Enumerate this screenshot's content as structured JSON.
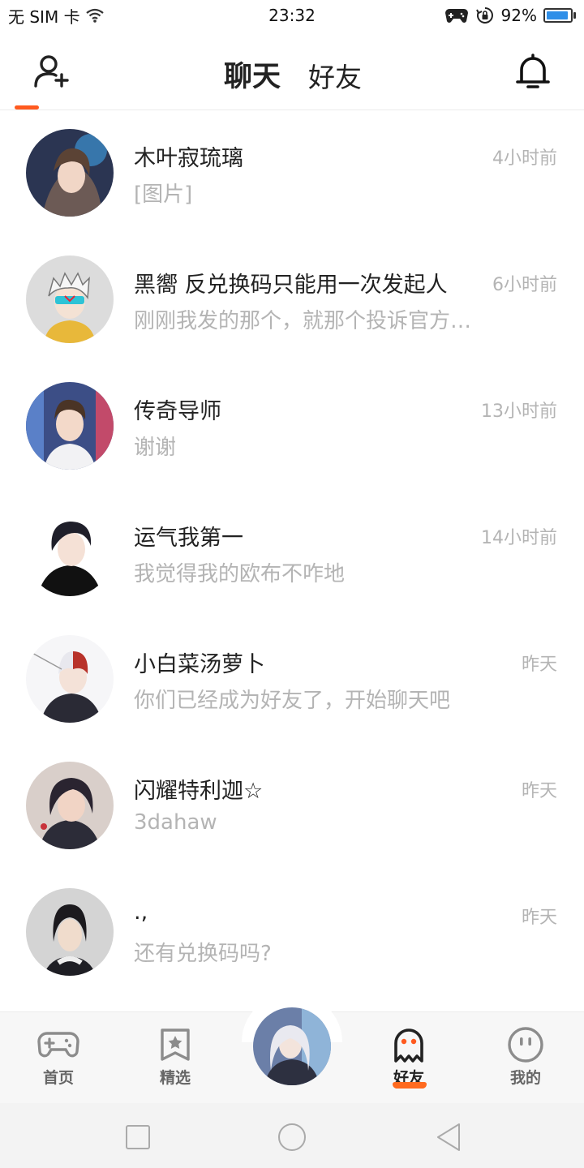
{
  "status_bar": {
    "carrier": "无 SIM 卡",
    "time": "23:32",
    "battery_percent": "92%",
    "battery_level": 0.92
  },
  "header": {
    "tabs": [
      {
        "label": "聊天",
        "active": true
      },
      {
        "label": "好友",
        "active": false
      }
    ],
    "accent_color": "#ff5a1f"
  },
  "chats": [
    {
      "name": "木叶寂琉璃",
      "preview": "[图片]",
      "time": "4小时前"
    },
    {
      "name": "黑嚮 反兑换码只能用一次发起人",
      "preview": "刚刚我发的那个，就那个投诉官方…",
      "time": "6小时前"
    },
    {
      "name": "传奇导师",
      "preview": "谢谢",
      "time": "13小时前"
    },
    {
      "name": "运气我第一",
      "preview": "我觉得我的欧布不咋地",
      "time": "14小时前"
    },
    {
      "name": "小白菜汤萝卜",
      "preview": "你们已经成为好友了，开始聊天吧",
      "time": "昨天"
    },
    {
      "name": "闪耀特利迦☆",
      "preview": "3dahaw",
      "time": "昨天"
    },
    {
      "name": ".,",
      "preview": "还有兑换码吗?",
      "time": "昨天"
    }
  ],
  "bottom_nav": {
    "items": [
      {
        "label": "首页",
        "icon": "gamepad-icon"
      },
      {
        "label": "精选",
        "icon": "star-bookmark-icon"
      },
      {
        "label": "好友",
        "icon": "ghost-icon",
        "active": true
      },
      {
        "label": "我的",
        "icon": "smiley-icon"
      }
    ]
  }
}
